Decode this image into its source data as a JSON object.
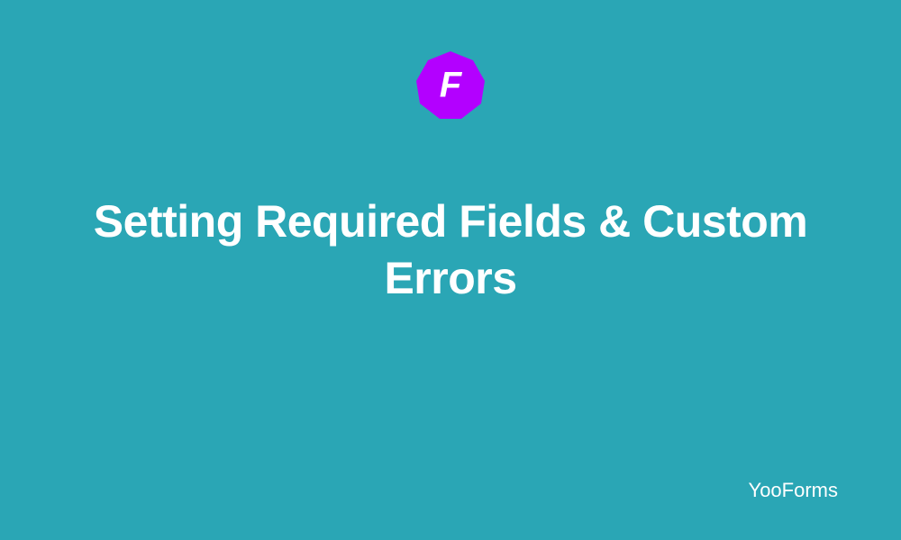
{
  "logo": {
    "letter": "F",
    "badge_color": "#B300FF"
  },
  "title": "Setting Required Fields & Custom Errors",
  "brand": "YooForms",
  "colors": {
    "background": "#2AA6B5",
    "text": "#FFFFFF"
  }
}
